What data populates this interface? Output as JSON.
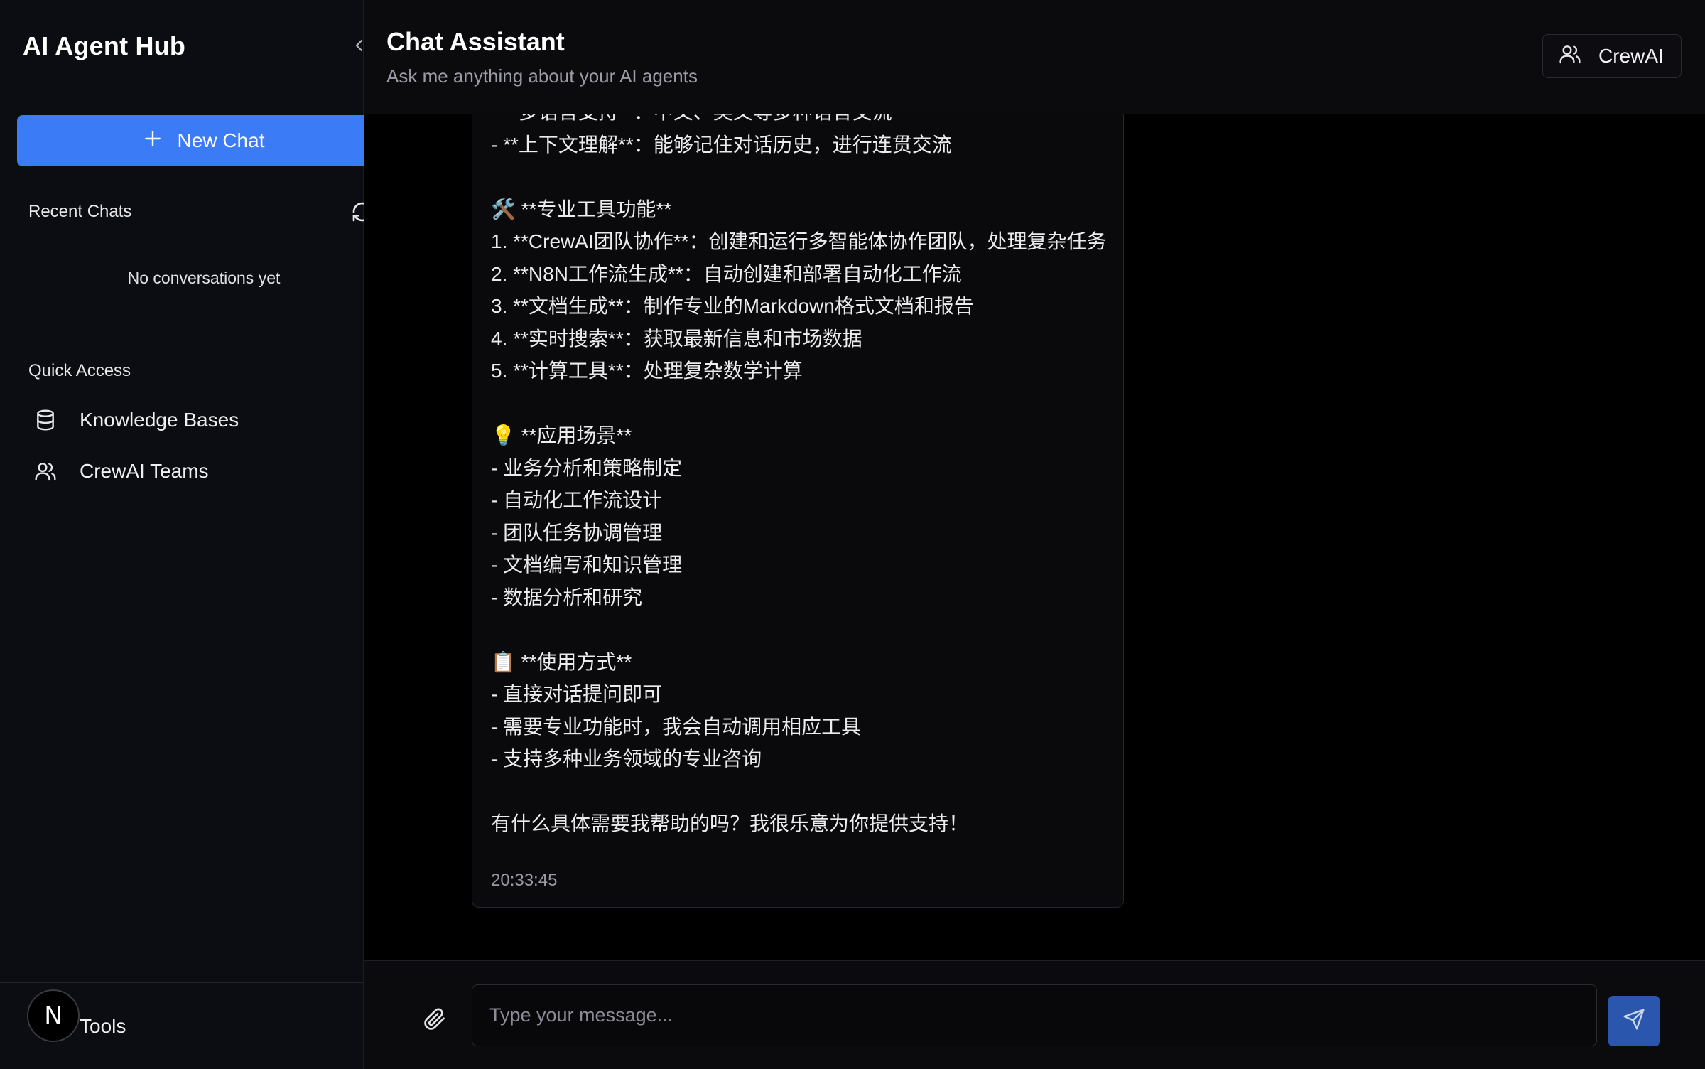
{
  "sidebar": {
    "title": "AI Agent Hub",
    "new_chat_label": "New Chat",
    "recent_chats_label": "Recent Chats",
    "empty_state": "No conversations yet",
    "quick_access_label": "Quick Access",
    "quick_access": [
      {
        "label": "Knowledge Bases",
        "icon": "database-icon"
      },
      {
        "label": "CrewAI Teams",
        "icon": "users-icon"
      }
    ],
    "footer_avatar_letter": "N",
    "footer_label": "Tools"
  },
  "header": {
    "title": "Chat Assistant",
    "subtitle": "Ask me anything about your AI agents",
    "mode_button_label": "CrewAI"
  },
  "message": {
    "lines": [
      "- **多语言支持**：中文、英文等多种语言交流",
      "- **上下文理解**：能够记住对话历史，进行连贯交流",
      "",
      "🛠️ **专业工具功能**",
      "1. **CrewAI团队协作**：创建和运行多智能体协作团队，处理复杂任务",
      "2. **N8N工作流生成**：自动创建和部署自动化工作流",
      "3. **文档生成**：制作专业的Markdown格式文档和报告",
      "4. **实时搜索**：获取最新信息和市场数据",
      "5. **计算工具**：处理复杂数学计算",
      "",
      "💡 **应用场景**",
      "- 业务分析和策略制定",
      "- 自动化工作流设计",
      "- 团队任务协调管理",
      "- 文档编写和知识管理",
      "- 数据分析和研究",
      "",
      "📋 **使用方式**",
      "- 直接对话提问即可",
      "- 需要专业功能时，我会自动调用相应工具",
      "- 支持多种业务领域的专业咨询",
      "",
      "有什么具体需要我帮助的吗？我很乐意为你提供支持！"
    ],
    "timestamp": "20:33:45"
  },
  "composer": {
    "placeholder": "Type your message...",
    "value": ""
  },
  "colors": {
    "accent": "#3b7bf5",
    "send_button": "#2a56ad",
    "sidebar_bg": "#0c0d12",
    "main_bg": "#000000"
  }
}
